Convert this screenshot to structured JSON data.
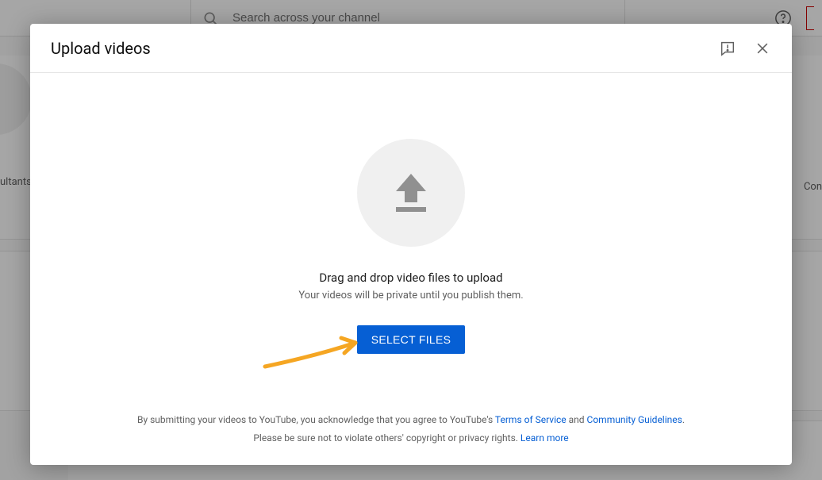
{
  "header": {
    "search_placeholder": "Search across your channel"
  },
  "bg": {
    "left_text_fragment": "ultants",
    "right_text_fragment": "Con"
  },
  "dialog": {
    "title": "Upload videos",
    "drag_title": "Drag and drop video files to upload",
    "drag_subtitle": "Your videos will be private until you publish them.",
    "select_button": "Select Files",
    "footer": {
      "line1_prefix": "By submitting your videos to YouTube, you acknowledge that you agree to YouTube's ",
      "tos": "Terms of Service",
      "and": " and ",
      "guidelines": "Community Guidelines",
      "period": ".",
      "line2_prefix": "Please be sure not to violate others' copyright or privacy rights. ",
      "learn_more": "Learn more"
    }
  },
  "icons": {
    "search": "search-icon",
    "help": "help-icon",
    "feedback": "feedback-icon",
    "close": "close-icon",
    "upload": "upload-icon"
  }
}
